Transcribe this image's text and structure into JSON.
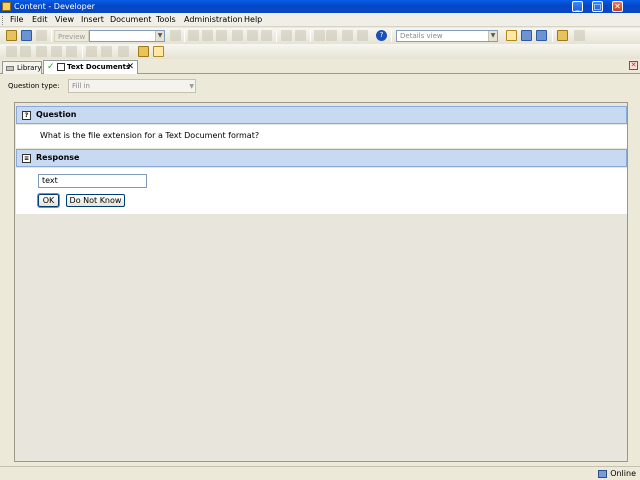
{
  "window": {
    "title": "Content - Developer",
    "controls": {
      "minimize": "_",
      "maximize": "□",
      "close": "✕"
    }
  },
  "menu": [
    "File",
    "Edit",
    "View",
    "Insert",
    "Document",
    "Tools",
    "Administration",
    "Help"
  ],
  "toolbar": {
    "preview_label": "Preview",
    "view_select": "Details view"
  },
  "tabs": [
    {
      "label": "Library",
      "icon": "library-icon"
    },
    {
      "label": "Text Documents",
      "icon": "check-icon",
      "close": "✕"
    }
  ],
  "question_type": {
    "label": "Question type:",
    "value": "Fill in"
  },
  "question": {
    "header": "Question",
    "text": "What is the file extension for a Text Document format?"
  },
  "response": {
    "header": "Response",
    "input_value": "text",
    "ok_label": "OK",
    "dont_know_label": "Do Not Know"
  },
  "status": {
    "text": "Online"
  },
  "colors": {
    "section_header_bg": "#c8daf2",
    "title_bar": "#0a5ee8"
  }
}
